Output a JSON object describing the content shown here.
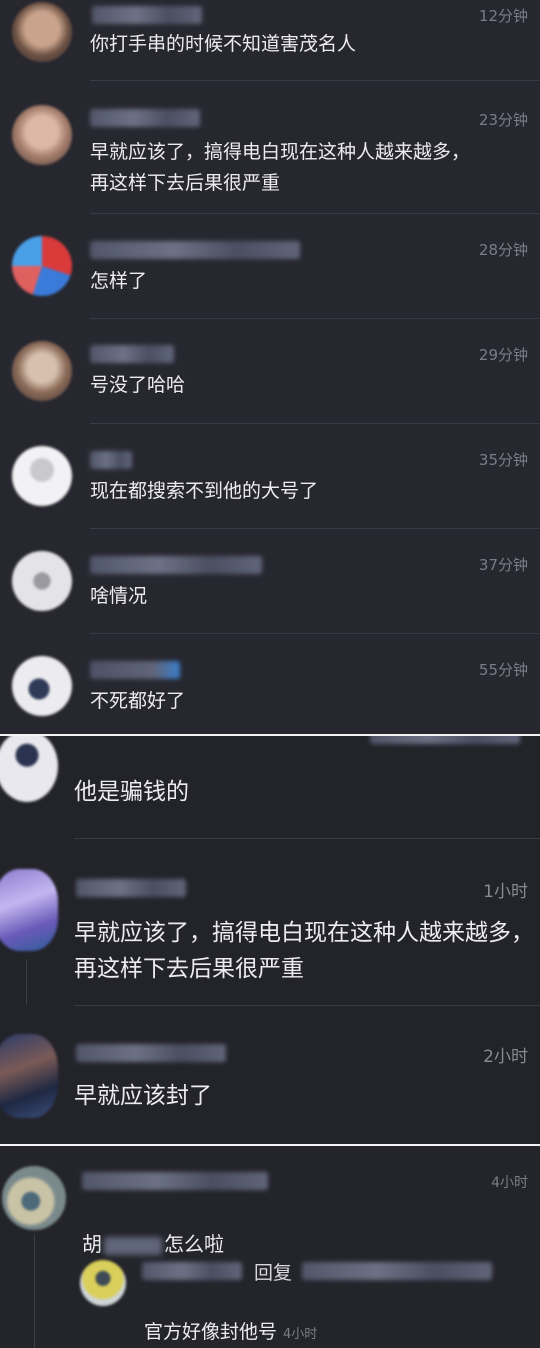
{
  "panel1": {
    "comments": [
      {
        "time": "12分钟",
        "text": "你打手串的时候不知道害茂名人"
      },
      {
        "time": "23分钟",
        "text": "早就应该了，搞得电白现在这种人越来越多，\n再这样下去后果很严重"
      },
      {
        "time": "28分钟",
        "text": "怎样了"
      },
      {
        "time": "29分钟",
        "text": "号没了哈哈"
      },
      {
        "time": "35分钟",
        "text": "现在都搜索不到他的大号了"
      },
      {
        "time": "37分钟",
        "text": "啥情况"
      },
      {
        "time": "55分钟",
        "text": "不死都好了"
      }
    ]
  },
  "panel2": {
    "comments": [
      {
        "time": "",
        "text": "他是骗钱的"
      },
      {
        "time": "1小时",
        "text": "早就应该了，搞得电白现在这种人越来越多，\n再这样下去后果很严重"
      },
      {
        "time": "2小时",
        "text": "早就应该封了"
      }
    ]
  },
  "panel3": {
    "comment": {
      "time": "4小时",
      "text_prefix": "胡",
      "text_suffix": "怎么啦"
    },
    "reply": {
      "reply_label": "回复",
      "text": "官方好像封他号",
      "time": "4小时"
    }
  }
}
